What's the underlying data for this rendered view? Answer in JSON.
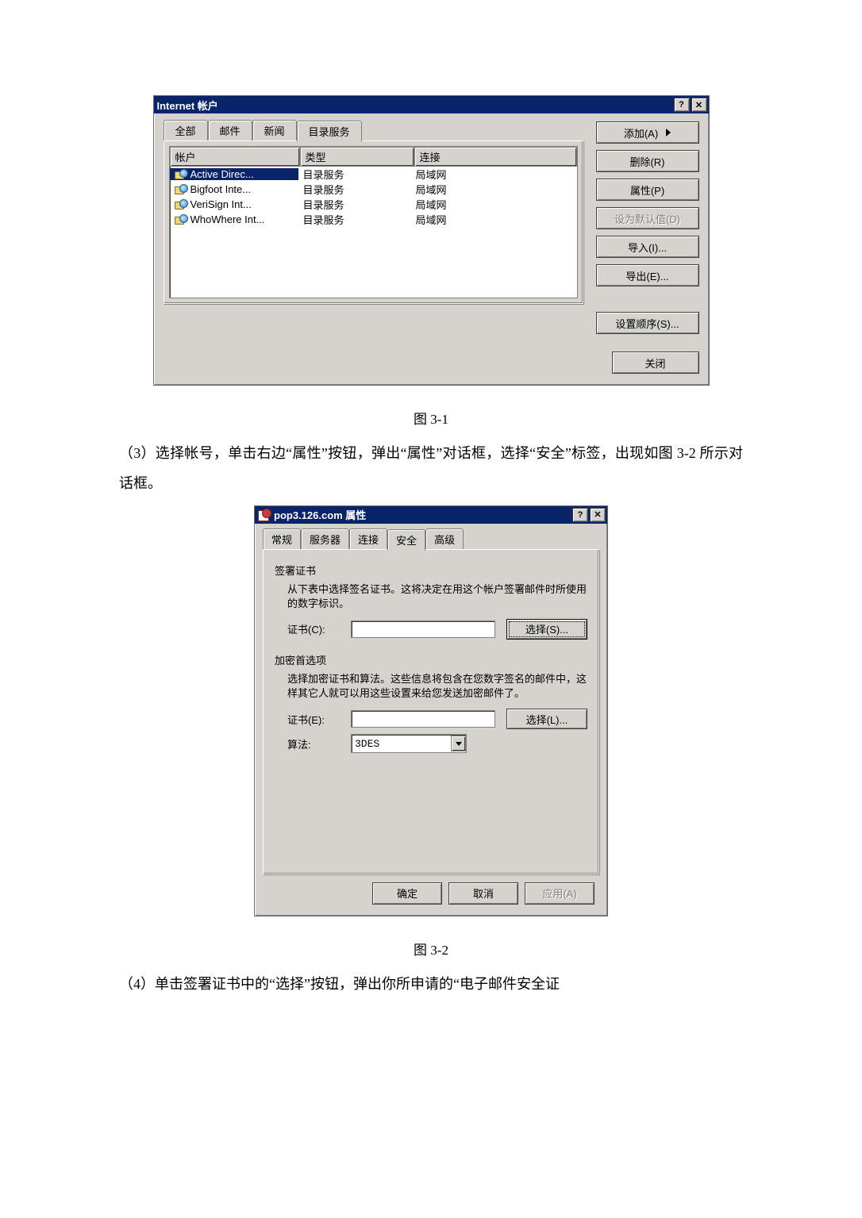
{
  "dialog1": {
    "title": "Internet 帐户",
    "tabs": {
      "all": "全部",
      "mail": "邮件",
      "news": "新闻",
      "dir": "目录服务"
    },
    "headers": {
      "account": "帐户",
      "type": "类型",
      "connection": "连接"
    },
    "rows": [
      {
        "name": "Active Direc...",
        "type": "目录服务",
        "conn": "局域网",
        "selected": true
      },
      {
        "name": "Bigfoot Inte...",
        "type": "目录服务",
        "conn": "局域网",
        "selected": false
      },
      {
        "name": "VeriSign Int...",
        "type": "目录服务",
        "conn": "局域网",
        "selected": false
      },
      {
        "name": "WhoWhere Int...",
        "type": "目录服务",
        "conn": "局域网",
        "selected": false
      }
    ],
    "buttons": {
      "add": "添加(A)",
      "remove": "删除(R)",
      "properties": "属性(P)",
      "set_default": "设为默认值(D)",
      "import": "导入(I)...",
      "export": "导出(E)...",
      "set_order": "设置顺序(S)...",
      "close": "关闭"
    }
  },
  "caption1": "图 3-1",
  "para3": "（3）选择帐号，单击右边“属性”按钮，弹出“属性”对话框，选择“安全”标签，出现如图 3-2 所示对话框。",
  "dialog2": {
    "title": "pop3.126.com 属性",
    "tabs": {
      "general": "常规",
      "server": "服务器",
      "connection": "连接",
      "security": "安全",
      "advanced": "高级"
    },
    "sign_section": {
      "title": "签署证书",
      "desc": "从下表中选择签名证书。这将决定在用这个帐户签署邮件时所使用的数字标识。",
      "cert_label": "证书(C):",
      "select_btn": "选择(S)..."
    },
    "enc_section": {
      "title": "加密首选项",
      "desc": "选择加密证书和算法。这些信息将包含在您数字签名的邮件中，这样其它人就可以用这些设置来给您发送加密邮件了。",
      "cert_label": "证书(E):",
      "select_btn": "选择(L)...",
      "algo_label": "算法:",
      "algo_value": "3DES"
    },
    "footer": {
      "ok": "确定",
      "cancel": "取消",
      "apply": "应用(A)"
    }
  },
  "caption2": "图 3-2",
  "para4": "（4）单击签署证书中的“选择”按钮，弹出你所申请的“电子邮件安全证"
}
